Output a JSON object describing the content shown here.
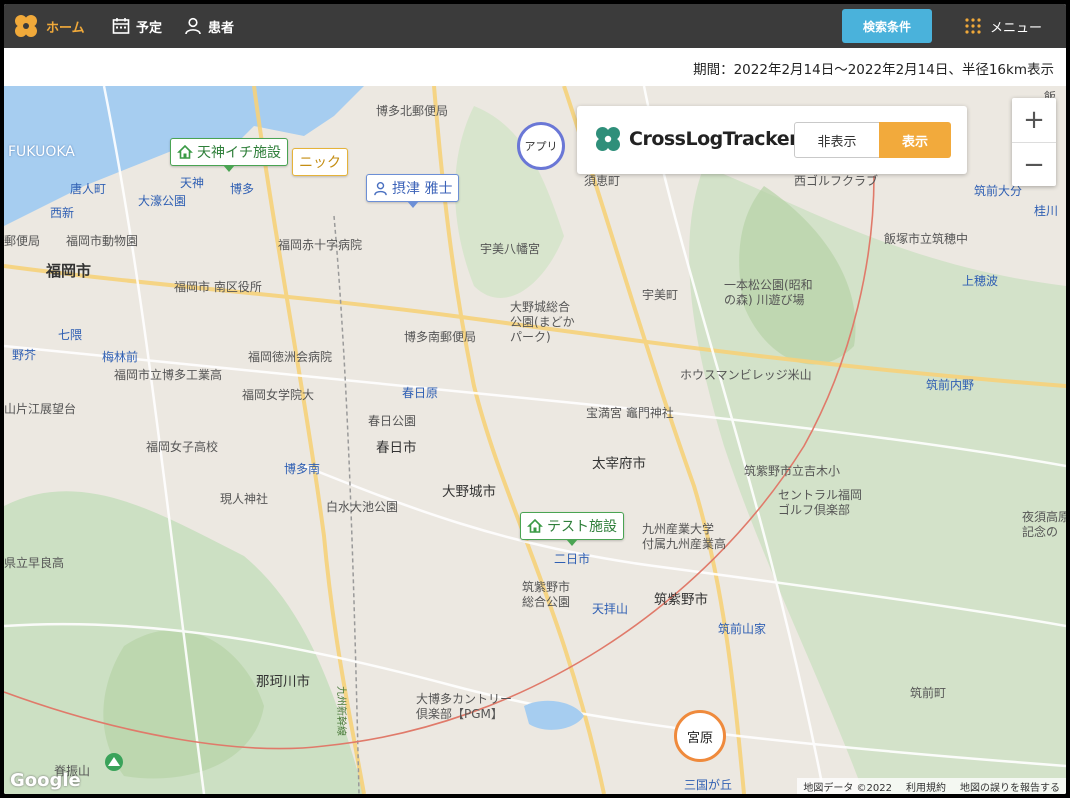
{
  "nav": {
    "home": "ホーム",
    "schedule": "予定",
    "patients": "患者",
    "search_conditions": "検索条件",
    "menu": "メニュー"
  },
  "period": "期間：2022年2月14日〜2022年2月14日、半径16km表示",
  "brand": {
    "name": "CrossLogTracker",
    "hide": "非表示",
    "show": "表示"
  },
  "markers": {
    "tenjin": "天神イチ施設",
    "clinic": "ニック",
    "patient": "摂津 雅士",
    "test": "テスト施設",
    "app": "アプリ",
    "miyahara": "宮原"
  },
  "zoom": {
    "in": "+",
    "out": "−"
  },
  "map_labels": {
    "fukuoka_city": "福岡市",
    "fukuoka_latin": "FUKUOKA",
    "hakata_kitayubin": "博多北郵便局",
    "tojinmachi": "唐人町",
    "nishijin": "西新",
    "ohori": "大濠公園",
    "tenjin": "天神",
    "hakata": "博多",
    "yubin": "郵便局",
    "zoo": "福岡市動物園",
    "sekijuji": "福岡赤十字病院",
    "minami_ward": "福岡市 南区役所",
    "umi_hachiman": "宇美八幡宮",
    "hakata_minami_yubin": "博多南郵便局",
    "tokushukai": "福岡徳洲会病院",
    "onojo_park": "大野城総合\n公園(まどか\nパーク)",
    "shichikuma": "七隈",
    "nokata": "野芥",
    "umedai": "梅林前",
    "hakata_kogyo": "福岡市立博多工業高",
    "joshigakuin": "福岡女学院大",
    "kasugabaru": "春日原",
    "kasuga_park": "春日公園",
    "kasuga_city": "春日市",
    "observatory": "山片江展望台",
    "joshi_high": "福岡女子高校",
    "hakataminami": "博多南",
    "genjin": "現人神社",
    "shiramizu": "白水大池公園",
    "onojo_city": "大野城市",
    "dazaifu_city": "太宰府市",
    "homangu": "宝満宮 竈門神社",
    "kyushu_sangyo": "九州産業大学\n付属九州産業高",
    "futsukaichi": "二日市",
    "chikushino_park": "筑紫野市\n総合公園",
    "tenpaizan": "天拝山",
    "chikushino_city": "筑紫野市",
    "nakagawa": "那珂川市",
    "dai_hakata": "大博多カントリー\n倶楽部【PGM】",
    "kyushu_shinkansen": "九州新幹線",
    "sefuri": "脊振山",
    "mikunigaoka": "三国が丘",
    "chikuzen_yamaie": "筑前山家",
    "chikuzen_mae": "筑前町",
    "housuman": "ホウスマンビレッジ米山",
    "chikushino_kogi": "筑紫野市立吉木小",
    "central_golf": "セントラル福岡\nゴルフ倶楽部",
    "iizuka_school": "飯塚市立筑穂中",
    "kamihonami": "上穂波",
    "chikuzen_uchino": "筑前内野",
    "ipponmatsu": "一本松公園(昭和\nの森) 川遊び場",
    "umi": "宇美町",
    "sue": "須恵町",
    "nishi_golf": "西ゴルフクラブ",
    "chikuzen_daibu": "筑前大分",
    "keisen": "桂川",
    "yozora": "夜須高原\n記念の",
    "fukuoka_ken_school": "県立早良高",
    "ikoi": "飯"
  },
  "attribution": {
    "google": "Google",
    "map_data": "地図データ ©2022",
    "terms": "利用規約",
    "report": "地図の誤りを報告する"
  },
  "colors": {
    "topbar": "#3b3b3b",
    "accent_orange": "#f2aa3c",
    "search_blue": "#4ab2db",
    "facility_green": "#4aa453",
    "patient_blue": "#6c8fd6",
    "radius_circle": "#e07a6a"
  }
}
